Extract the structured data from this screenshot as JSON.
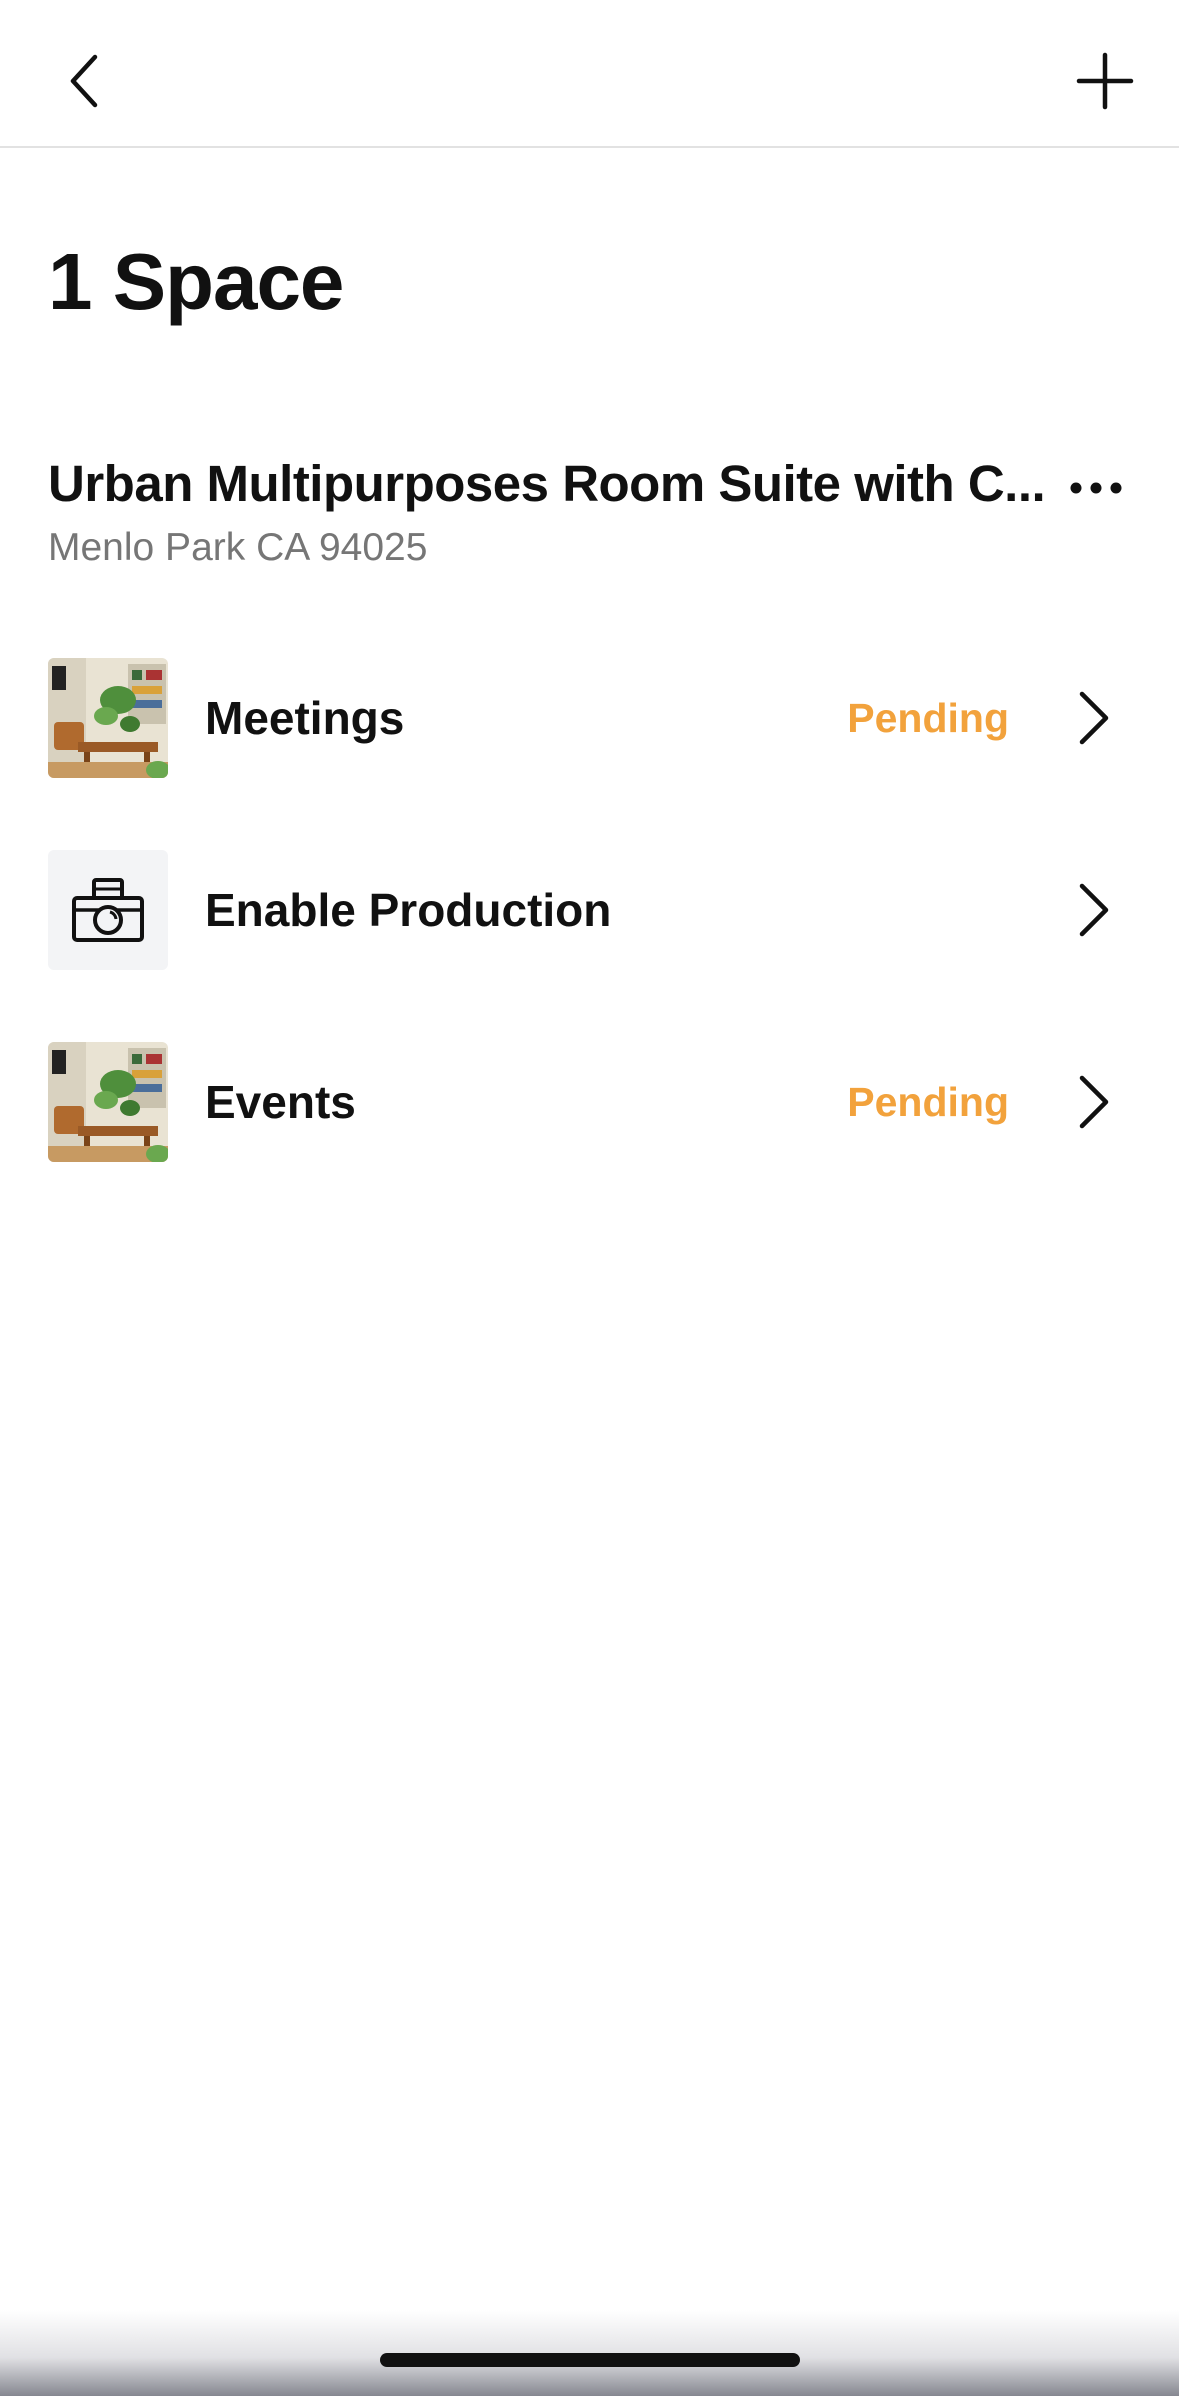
{
  "header": {
    "back_icon": "chevron-left-icon",
    "add_icon": "plus-icon"
  },
  "page_title": "1 Space",
  "space": {
    "name": "Urban Multipurposes Room Suite with C...",
    "address": "Menlo Park CA 94025",
    "more_icon": "more-horizontal-icon"
  },
  "rows": [
    {
      "label": "Meetings",
      "status": "Pending",
      "thumb": "room-photo",
      "chevron_icon": "chevron-right-icon"
    },
    {
      "label": "Enable Production",
      "status": "",
      "thumb": "camera-icon",
      "chevron_icon": "chevron-right-icon"
    },
    {
      "label": "Events",
      "status": "Pending",
      "thumb": "room-photo",
      "chevron_icon": "chevron-right-icon"
    }
  ],
  "colors": {
    "status_pending": "#f2a23c",
    "address_gray": "#767676",
    "divider": "#e2e2e2"
  }
}
